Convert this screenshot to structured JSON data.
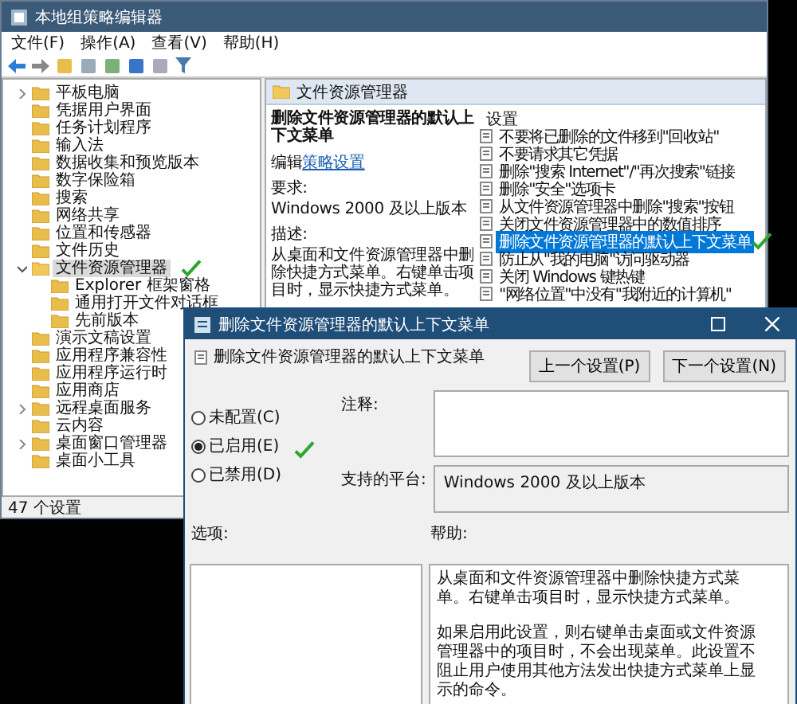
{
  "main_window": {
    "title": "本地组策略编辑器",
    "menu": [
      "文件(F)",
      "操作(A)",
      "查看(V)",
      "帮助(H)"
    ],
    "tree": [
      {
        "label": "平板电脑",
        "expanded": false,
        "selected": false
      },
      {
        "label": "凭据用户界面",
        "selected": false
      },
      {
        "label": "任务计划程序",
        "selected": false
      },
      {
        "label": "输入法",
        "selected": false
      },
      {
        "label": "数据收集和预览版本",
        "selected": false
      },
      {
        "label": "数字保险箱",
        "selected": false
      },
      {
        "label": "搜索",
        "selected": false
      },
      {
        "label": "网络共享",
        "selected": false
      },
      {
        "label": "位置和传感器",
        "selected": false
      },
      {
        "label": "文件历史",
        "selected": false
      },
      {
        "label": "文件资源管理器",
        "expanded": true,
        "selected": true,
        "check_mark": true,
        "children": [
          {
            "label": "Explorer 框架窗格",
            "selected": false
          },
          {
            "label": "通用打开文件对话框",
            "selected": false
          },
          {
            "label": "先前版本",
            "selected": false
          }
        ]
      },
      {
        "label": "演示文稿设置",
        "selected": false
      },
      {
        "label": "应用程序兼容性",
        "selected": false
      },
      {
        "label": "应用程序运行时",
        "selected": false
      },
      {
        "label": "应用商店",
        "selected": false
      },
      {
        "label": "远程桌面服务",
        "expanded": false,
        "selected": false
      },
      {
        "label": "云内容",
        "selected": false
      },
      {
        "label": "桌面窗口管理器",
        "expanded": false,
        "selected": false
      },
      {
        "label": "桌面小工具",
        "selected": false
      }
    ],
    "status_bar": "47 个设置",
    "detail": {
      "header": "文件资源管理器",
      "policy_title": "删除文件资源管理器的默认上下文菜单",
      "edit_prefix": "编辑",
      "edit_link": "策略设置",
      "requirements_label": "要求:",
      "requirements": "Windows 2000 及以上版本",
      "description_label": "描述:",
      "description": "从桌面和文件资源管理器中删除快捷方式菜单。右键单击项目时，显示快捷方式菜单。"
    },
    "settings": {
      "column": "设置",
      "rows": [
        {
          "label": "不要将已删除的文件移到\"回收站\"",
          "selected": false
        },
        {
          "label": "不要请求其它凭据",
          "selected": false
        },
        {
          "label": "删除\"搜索 Internet\"/\"再次搜索\"链接",
          "selected": false
        },
        {
          "label": "删除\"安全\"选项卡",
          "selected": false
        },
        {
          "label": "从文件资源管理器中删除\"搜索\"按钮",
          "selected": false
        },
        {
          "label": "关闭文件资源管理器中的数值排序",
          "selected": false
        },
        {
          "label": "删除文件资源管理器的默认上下文菜单",
          "selected": true,
          "check_mark": true
        },
        {
          "label": "防止从\"我的电脑\"访问驱动器",
          "selected": false
        },
        {
          "label": "关闭 Windows 键热键",
          "selected": false
        },
        {
          "label": "\"网络位置\"中没有\"我附近的计算机\"",
          "selected": false
        }
      ]
    }
  },
  "dialog": {
    "title": "删除文件资源管理器的默认上下文菜单",
    "heading": "删除文件资源管理器的默认上下文菜单",
    "buttons": [
      "上一个设置(P)",
      "下一个设置(N)"
    ],
    "radios": [
      {
        "label": "未配置(C)",
        "selected": false
      },
      {
        "label": "已启用(E)",
        "selected": true,
        "check_mark": true
      },
      {
        "label": "已禁用(D)",
        "selected": false
      }
    ],
    "comment_label": "注释:",
    "platform_label": "支持的平台:",
    "platform": "Windows 2000 及以上版本",
    "options_label": "选项:",
    "help_label": "帮助:",
    "help": [
      "从桌面和文件资源管理器中删除快捷方式菜单。右键单击项目时，显示快捷方式菜单。",
      "如果启用此设置，则右键单击桌面或文件资源管理器中的项目时，不会出现菜单。此设置不阻止用户使用其他方法发出快捷方式菜单上显示的命令。"
    ]
  }
}
